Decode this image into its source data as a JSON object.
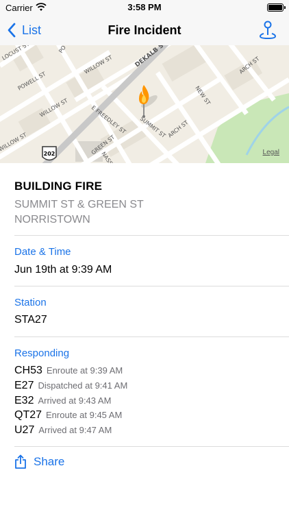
{
  "status_bar": {
    "carrier": "Carrier",
    "time": "3:58 PM"
  },
  "nav": {
    "back_label": "List",
    "title": "Fire Incident"
  },
  "map": {
    "legal": "Legal",
    "street_labels": [
      "DEKALB S",
      "WILLOW ST",
      "POWELL ST",
      "WILLOW ST",
      "E FREEDLEY ST",
      "SUMMIT ST",
      "ARCH ST",
      "NEW ST",
      "ARCH ST",
      "GREEN ST",
      "WILLOW ST",
      "LOCUST ST",
      "PO",
      "NASS"
    ],
    "route_shield": "202"
  },
  "incident": {
    "title": "BUILDING FIRE",
    "address_line1": "SUMMIT ST & GREEN ST",
    "address_line2": "NORRISTOWN"
  },
  "date_time": {
    "label": "Date & Time",
    "value": "Jun 19th at 9:39 AM"
  },
  "station": {
    "label": "Station",
    "value": "STA27"
  },
  "responding": {
    "label": "Responding",
    "units": [
      {
        "unit": "CH53",
        "status": "Enroute at 9:39 AM"
      },
      {
        "unit": "E27",
        "status": "Dispatched at 9:41 AM"
      },
      {
        "unit": "E32",
        "status": "Arrived at 9:43 AM"
      },
      {
        "unit": "QT27",
        "status": "Enroute at 9:45 AM"
      },
      {
        "unit": "U27",
        "status": "Arrived at 9:47 AM"
      }
    ]
  },
  "share": {
    "label": "Share"
  },
  "colors": {
    "accent": "#1a73e8",
    "secondary_text": "#8a8a8e",
    "pin": "#ff9500"
  }
}
